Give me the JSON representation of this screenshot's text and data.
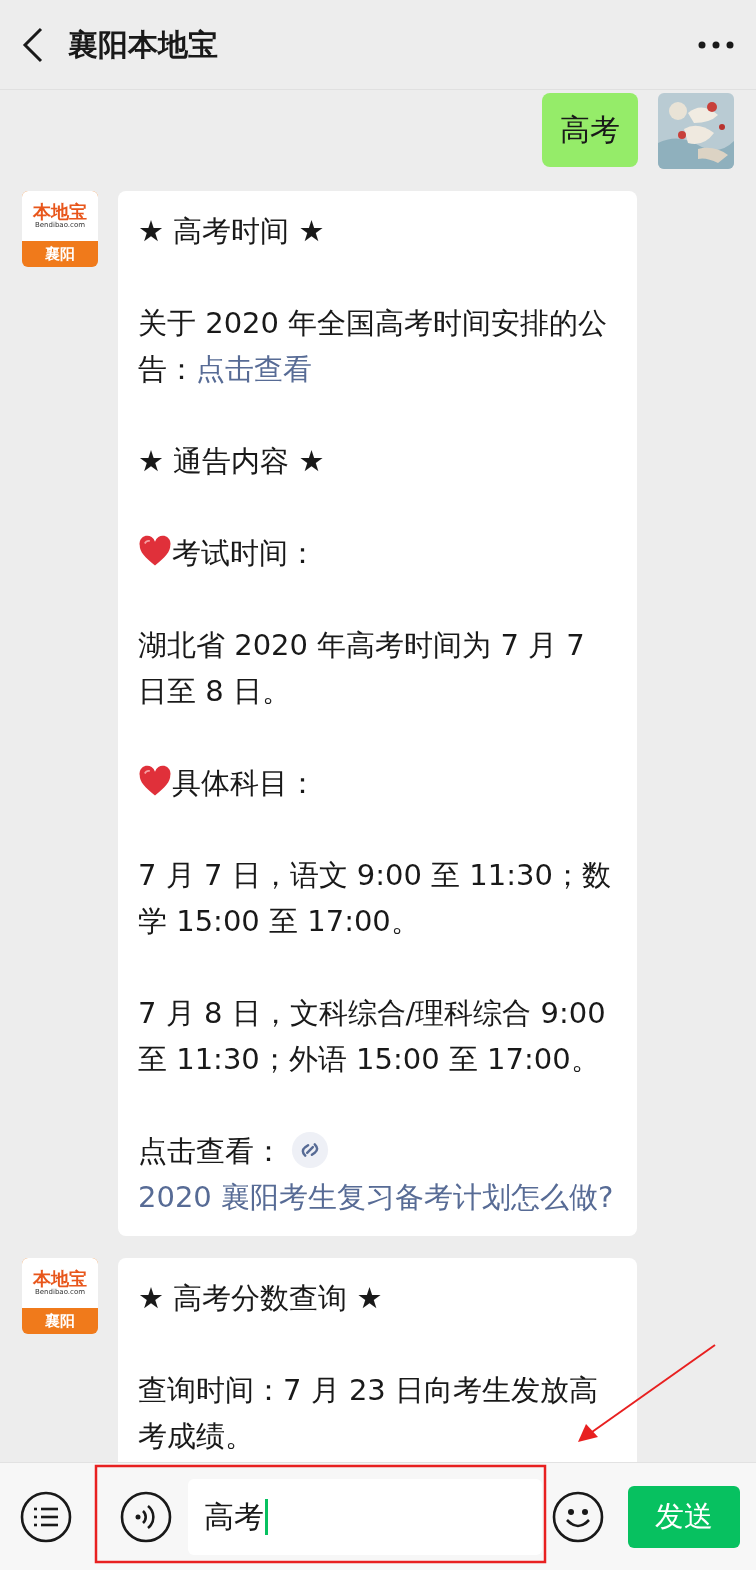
{
  "header": {
    "title": "襄阳本地宝"
  },
  "messages": [
    {
      "kind": "sent",
      "text": "高考"
    },
    {
      "kind": "received",
      "avatar": {
        "brand": "本地宝",
        "site": "Bendibao.com",
        "city": "襄阳"
      },
      "paragraphs": [
        [
          {
            "kind": "text",
            "text": "★ 高考时间 ★"
          }
        ],
        [
          {
            "kind": "text",
            "text": "关于 2020 年全国高考时间安排的公告："
          },
          {
            "kind": "link",
            "text": "点击查看"
          }
        ],
        [
          {
            "kind": "text",
            "text": "★ 通告内容 ★"
          }
        ],
        [
          {
            "kind": "heart"
          },
          {
            "kind": "text",
            "text": "考试时间："
          }
        ],
        [
          {
            "kind": "text",
            "text": "湖北省 2020 年高考时间为 7 月 7 日至 8 日。"
          }
        ],
        [
          {
            "kind": "heart"
          },
          {
            "kind": "text",
            "text": "具体科目："
          }
        ],
        [
          {
            "kind": "text",
            "text": "7 月 7 日，语文 9:00 至 11:30；数学 15:00 至 17:00。"
          }
        ],
        [
          {
            "kind": "text",
            "text": "7 月 8 日，文科综合/理科综合 9:00 至 11:30；外语 15:00 至 17:00。"
          }
        ],
        [
          {
            "kind": "text",
            "text": "点击查看："
          },
          {
            "kind": "mini"
          },
          {
            "kind": "link",
            "text": "2020 襄阳考生复习备考计划怎么做?"
          }
        ]
      ]
    },
    {
      "kind": "received",
      "avatar": {
        "brand": "本地宝",
        "site": "Bendibao.com",
        "city": "襄阳"
      },
      "paragraphs": [
        [
          {
            "kind": "text",
            "text": "★ 高考分数查询 ★"
          }
        ],
        [
          {
            "kind": "text",
            "text": "查询时间：7 月 23 日向考生发放高考成绩。"
          }
        ]
      ]
    }
  ],
  "composer": {
    "value": "高考",
    "send_label": "发送"
  }
}
